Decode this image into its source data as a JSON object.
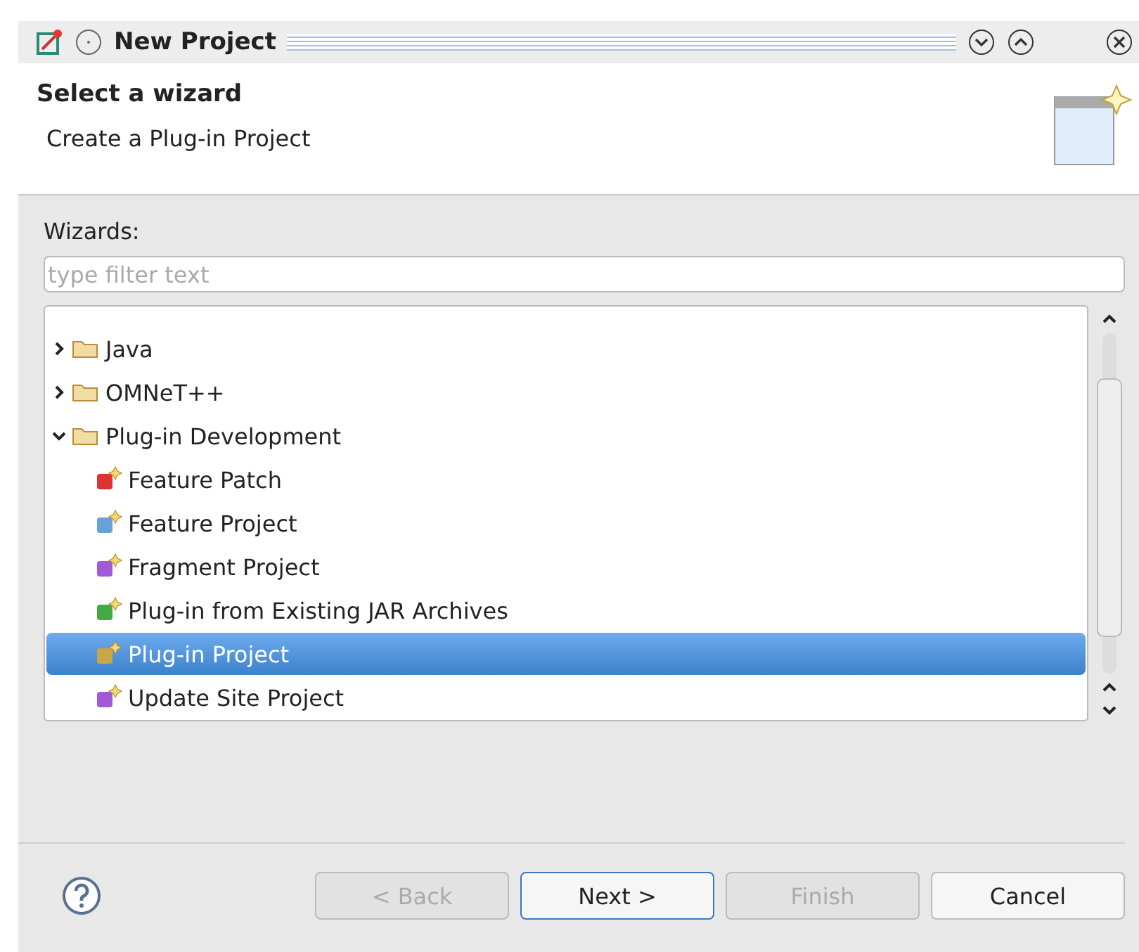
{
  "window": {
    "title": "New Project"
  },
  "header": {
    "title": "Select a wizard",
    "description": "Create a Plug-in Project"
  },
  "wizards_label": "Wizards:",
  "filter": {
    "placeholder": "type filter text"
  },
  "tree": [
    {
      "label": "Java",
      "kind": "folder",
      "expanded": false,
      "selected": false
    },
    {
      "label": "OMNeT++",
      "kind": "folder",
      "expanded": false,
      "selected": false
    },
    {
      "label": "Plug-in Development",
      "kind": "folder",
      "expanded": true,
      "selected": false,
      "children": [
        {
          "label": "Feature Patch",
          "kind": "patch",
          "selected": false
        },
        {
          "label": "Feature Project",
          "kind": "feature",
          "selected": false
        },
        {
          "label": "Fragment Project",
          "kind": "fragment",
          "selected": false
        },
        {
          "label": "Plug-in from Existing JAR Archives",
          "kind": "jar",
          "selected": false
        },
        {
          "label": "Plug-in Project",
          "kind": "plugin",
          "selected": true
        },
        {
          "label": "Update Site Project",
          "kind": "site",
          "selected": false
        }
      ]
    }
  ],
  "buttons": [
    {
      "label": "< Back",
      "disabled": true,
      "default": false
    },
    {
      "label": "Next >",
      "disabled": false,
      "default": true
    },
    {
      "label": "Finish",
      "disabled": true,
      "default": false
    },
    {
      "label": "Cancel",
      "disabled": false,
      "default": false
    }
  ]
}
